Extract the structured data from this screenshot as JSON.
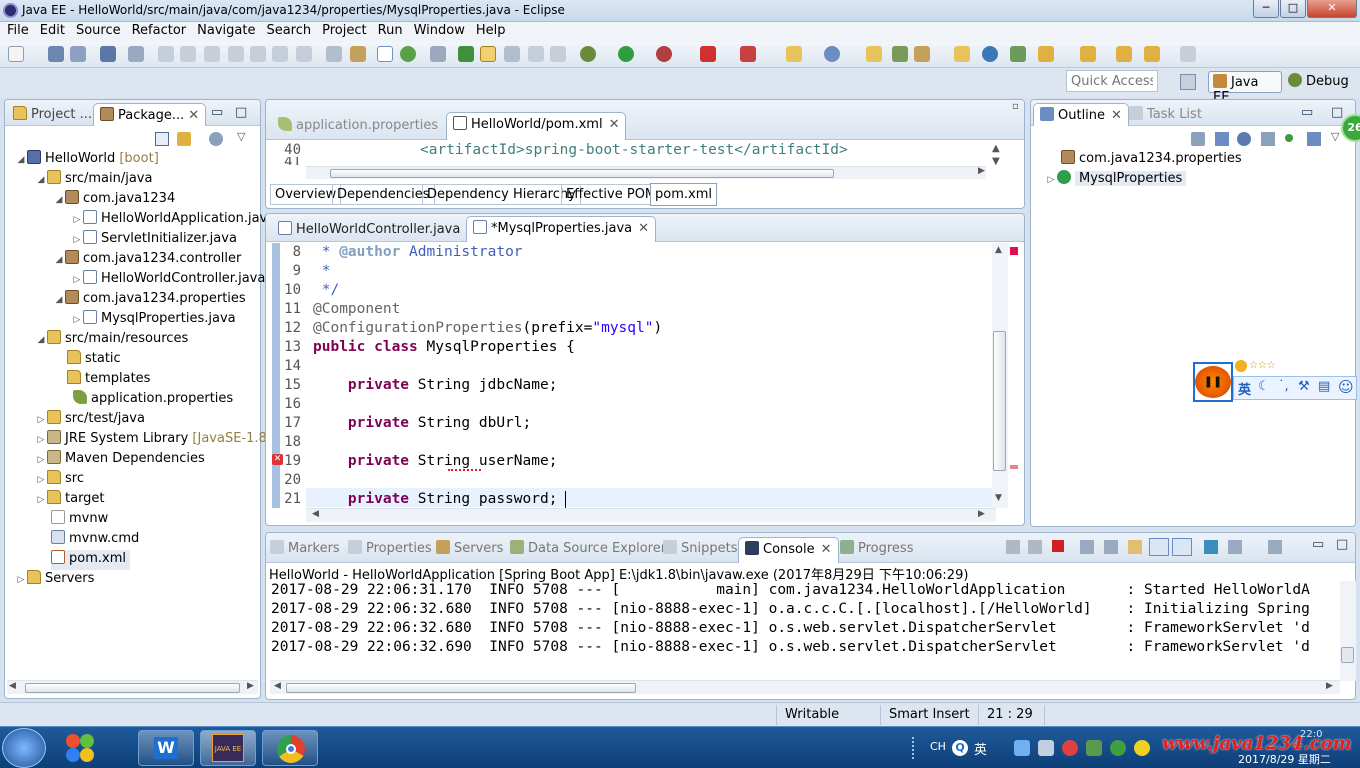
{
  "window": {
    "title": "Java EE - HelloWorld/src/main/java/com/java1234/properties/MysqlProperties.java - Eclipse",
    "minimize": "─",
    "maximize": "□",
    "close": "✕"
  },
  "menu": [
    "File",
    "Edit",
    "Source",
    "Refactor",
    "Navigate",
    "Search",
    "Project",
    "Run",
    "Window",
    "Help"
  ],
  "perspective": {
    "quick_access_placeholder": "Quick Access",
    "java_ee": "Java EE",
    "debug": "Debug"
  },
  "explorer": {
    "tabs": [
      "Project ...",
      "Package..."
    ],
    "items": [
      {
        "label": "HelloWorld",
        "suffix": "[boot]"
      },
      {
        "label": "src/main/java"
      },
      {
        "label": "com.java1234"
      },
      {
        "label": "HelloWorldApplication.jav"
      },
      {
        "label": "ServletInitializer.java"
      },
      {
        "label": "com.java1234.controller"
      },
      {
        "label": "HelloWorldController.java"
      },
      {
        "label": "com.java1234.properties"
      },
      {
        "label": "MysqlProperties.java"
      },
      {
        "label": "src/main/resources"
      },
      {
        "label": "static"
      },
      {
        "label": "templates"
      },
      {
        "label": "application.properties"
      },
      {
        "label": "src/test/java"
      },
      {
        "label": "JRE System Library",
        "suffix": "[JavaSE-1.8]"
      },
      {
        "label": "Maven Dependencies"
      },
      {
        "label": "src"
      },
      {
        "label": "target"
      },
      {
        "label": "mvnw"
      },
      {
        "label": "mvnw.cmd"
      },
      {
        "label": "pom.xml"
      },
      {
        "label": "Servers"
      }
    ]
  },
  "pom_editor": {
    "tabs": [
      "application.properties",
      "HelloWorld/pom.xml"
    ],
    "line": "40",
    "line2": "41",
    "code": "<artifactId>spring-boot-starter-test</artifactId>",
    "subtabs": [
      "Overview",
      "Dependencies",
      "Dependency Hierarchy",
      "Effective POM",
      "pom.xml"
    ]
  },
  "java_editor": {
    "tabs": [
      "HelloWorldController.java",
      "*MysqlProperties.java"
    ],
    "lines": [
      {
        "n": "8",
        "text": " * @author Administrator"
      },
      {
        "n": "9",
        "text": " *"
      },
      {
        "n": "10",
        "text": " */"
      },
      {
        "n": "11",
        "text": "@Component"
      },
      {
        "n": "12",
        "text": "@ConfigurationProperties(prefix=\"mysql\")"
      },
      {
        "n": "13",
        "text": "public class MysqlProperties {"
      },
      {
        "n": "14",
        "text": ""
      },
      {
        "n": "15",
        "text": "    private String jdbcName;"
      },
      {
        "n": "16",
        "text": ""
      },
      {
        "n": "17",
        "text": "    private String dbUrl;"
      },
      {
        "n": "18",
        "text": ""
      },
      {
        "n": "19",
        "text": "    private String userName;"
      },
      {
        "n": "20",
        "text": ""
      },
      {
        "n": "21",
        "text": "    private String password;"
      }
    ]
  },
  "outline": {
    "tabs": [
      "Outline",
      "Task List"
    ],
    "items": [
      "com.java1234.properties",
      "MysqlProperties"
    ],
    "badge": "26"
  },
  "ime": {
    "stars": "☆☆☆",
    "lang": "英",
    "pause": "❚❚"
  },
  "console": {
    "tabs": [
      "Markers",
      "Properties",
      "Servers",
      "Data Source Explorer",
      "Snippets",
      "Console",
      "Progress"
    ],
    "header": "HelloWorld - HelloWorldApplication [Spring Boot App] E:\\jdk1.8\\bin\\javaw.exe (2017年8月29日 下午10:06:29)",
    "lines": [
      "2017-08-29 22:06:31.170  INFO 5708 --- [           main] com.java1234.HelloWorldApplication       : Started HelloWorldA",
      "2017-08-29 22:06:32.680  INFO 5708 --- [nio-8888-exec-1] o.a.c.c.C.[.[localhost].[/HelloWorld]    : Initializing Spring",
      "2017-08-29 22:06:32.680  INFO 5708 --- [nio-8888-exec-1] o.s.web.servlet.DispatcherServlet        : FrameworkServlet 'd",
      "2017-08-29 22:06:32.690  INFO 5708 --- [nio-8888-exec-1] o.s.web.servlet.DispatcherServlet        : FrameworkServlet 'd"
    ]
  },
  "status": {
    "writable": "Writable",
    "insert": "Smart Insert",
    "position": "21 : 29"
  },
  "taskbar": {
    "eclipse_label": "JAVA EE",
    "tray_text": "CH",
    "ime": "英",
    "watermark": "www.java1234.com",
    "clock": "22:0",
    "date": "2017/8/29 星期二"
  },
  "colors": {
    "accent": "#1e5a9a",
    "keyword": "#7f0055",
    "string": "#2a00ff",
    "javadoc": "#3f5fbf"
  }
}
